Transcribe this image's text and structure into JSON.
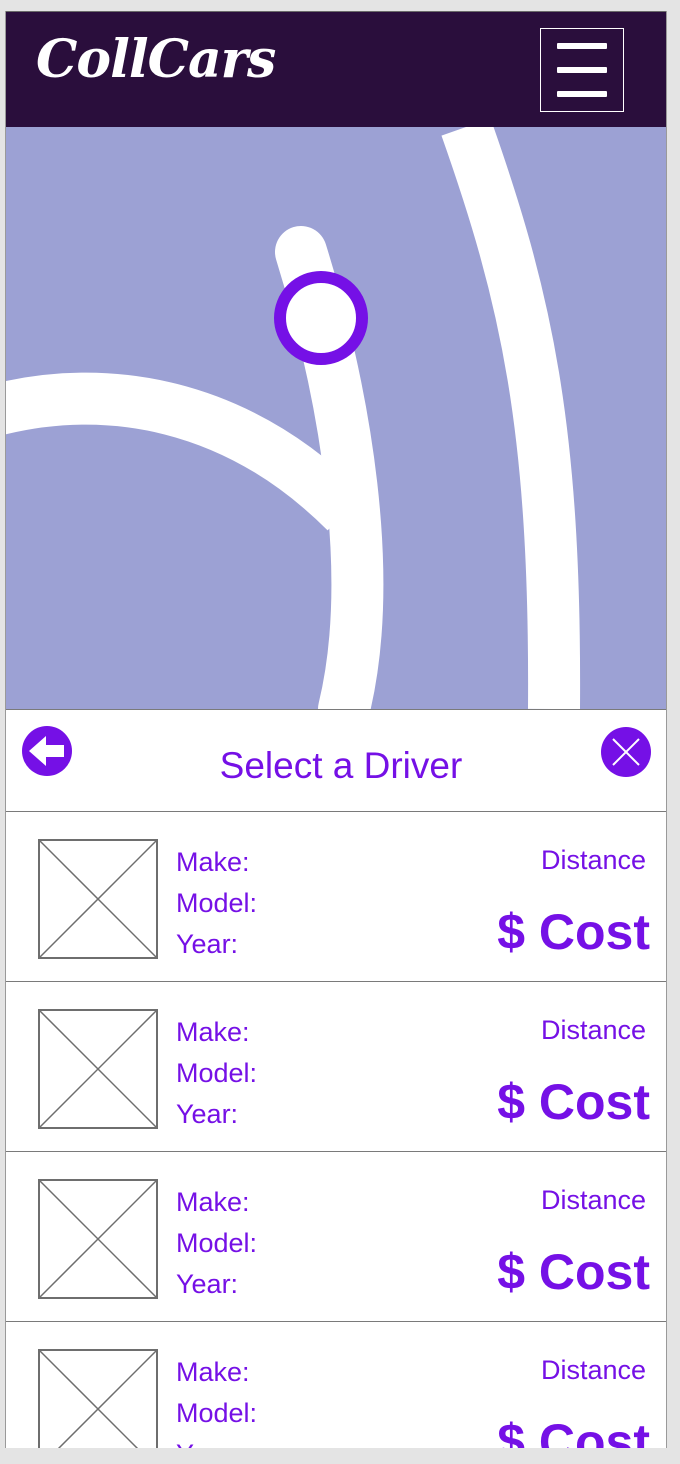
{
  "app": {
    "logo_text": "CollCars"
  },
  "header": {
    "menu_icon": "hamburger-icon"
  },
  "map": {
    "background_color": "#9ca1d4",
    "road_color": "#ffffff",
    "marker_color": "#7510e6",
    "marker_icon": "location-marker-icon"
  },
  "panel": {
    "title": "Select a Driver",
    "back_icon": "back-arrow-icon",
    "close_icon": "close-icon",
    "accent_color": "#7510e6"
  },
  "drivers": [
    {
      "make_label": "Make:",
      "model_label": "Model:",
      "year_label": "Year:",
      "distance": "Distance",
      "cost": "$ Cost",
      "photo_icon": "image-placeholder-icon"
    },
    {
      "make_label": "Make:",
      "model_label": "Model:",
      "year_label": "Year:",
      "distance": "Distance",
      "cost": "$ Cost",
      "photo_icon": "image-placeholder-icon"
    },
    {
      "make_label": "Make:",
      "model_label": "Model:",
      "year_label": "Year:",
      "distance": "Distance",
      "cost": "$ Cost",
      "photo_icon": "image-placeholder-icon"
    },
    {
      "make_label": "Make:",
      "model_label": "Model:",
      "year_label": "Year:",
      "distance": "Distance",
      "cost": "$ Cost",
      "photo_icon": "image-placeholder-icon"
    }
  ]
}
